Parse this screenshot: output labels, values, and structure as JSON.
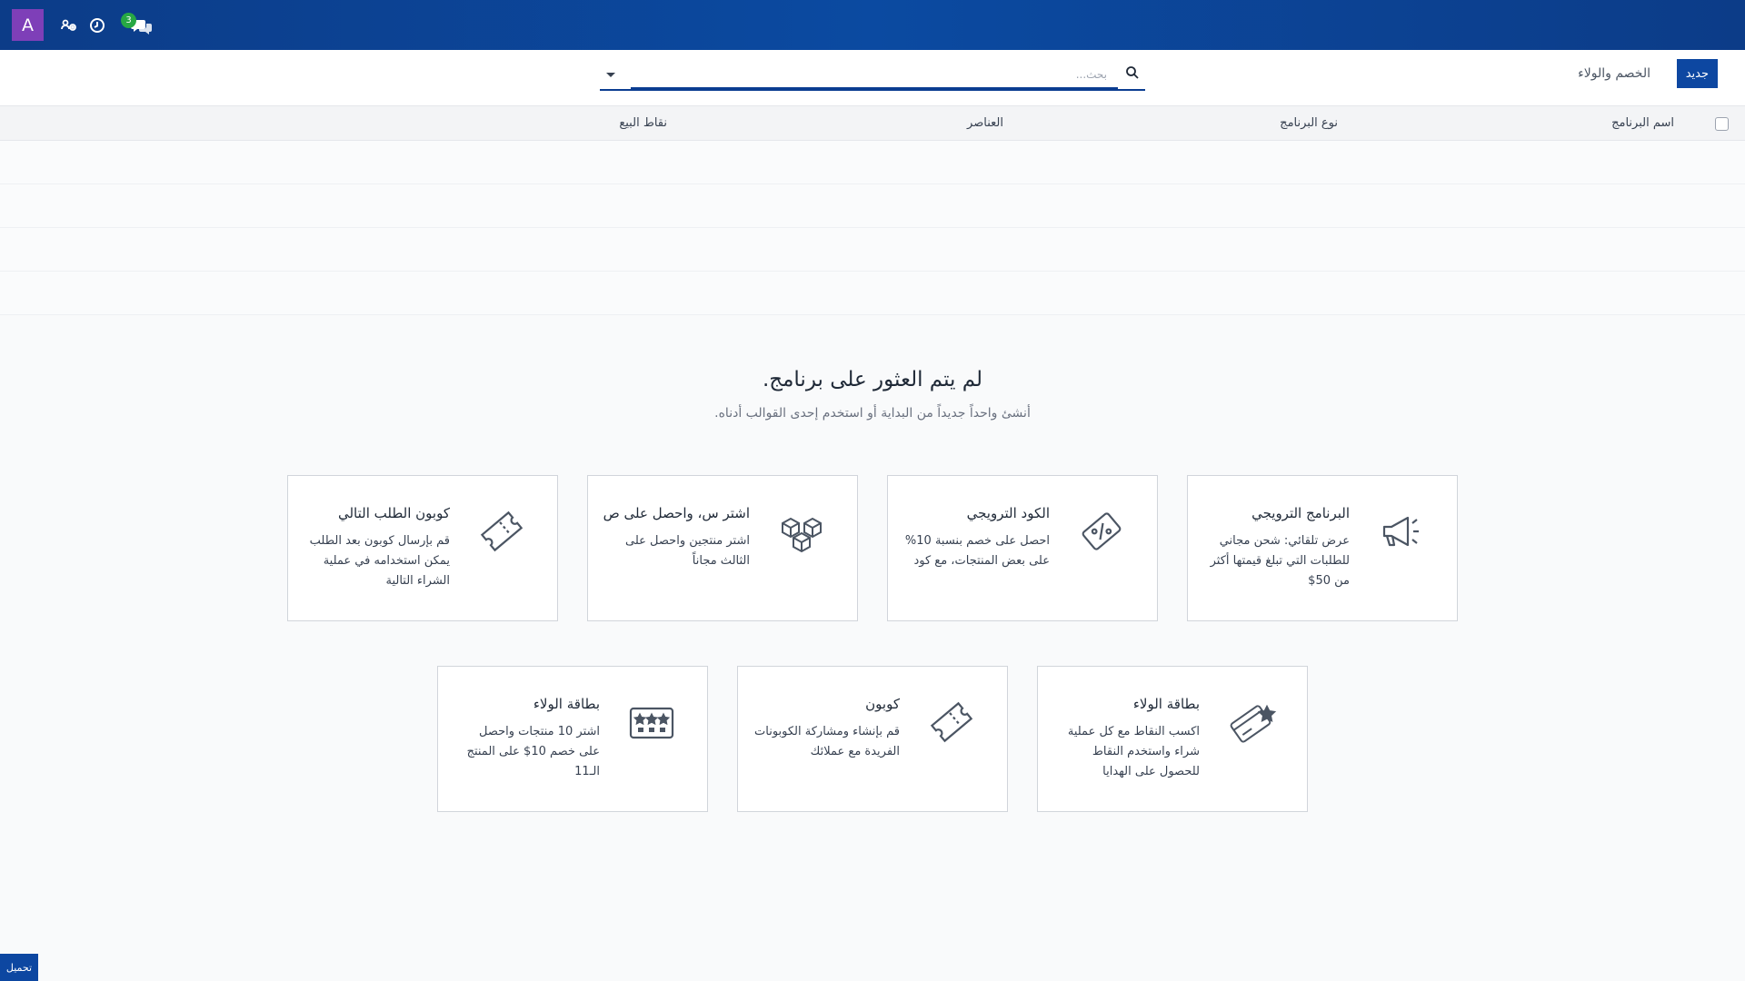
{
  "topbar": {
    "avatar_letter": "A",
    "notification_count": "3",
    "icons": [
      "users-gear-icon",
      "clock-icon",
      "chat-icon"
    ]
  },
  "toolbar": {
    "new_label": "جديد",
    "breadcrumb": "الخصم والولاء",
    "search_placeholder": "بحث..."
  },
  "table": {
    "columns": [
      "اسم البرنامج",
      "نوع البرنامج",
      "العناصر",
      "نقاط البيع"
    ]
  },
  "empty_state": {
    "title": "لم يتم العثور على برنامج.",
    "subtitle": "أنشئ واحداً جديداً من البداية أو استخدم إحدى القوالب أدناه."
  },
  "templates": [
    {
      "title": "البرنامج الترويجي",
      "desc": "عرض تلقائي: شحن مجاني للطلبات التي تبلغ قيمتها أكثر من 50$",
      "icon": "megaphone-icon"
    },
    {
      "title": "الكود الترويجي",
      "desc": "احصل على خصم بنسبة 10% على بعض المنتجات، مع كود",
      "icon": "discount-ticket-icon"
    },
    {
      "title": "اشتر س، واحصل على ص",
      "desc": "اشتر منتجين واحصل على الثالث مجاناً",
      "icon": "boxes-icon"
    },
    {
      "title": "كوبون الطلب التالي",
      "desc": "قم بإرسال كوبون بعد الطلب يمكن استخدامه في عملية الشراء التالية",
      "icon": "ticket-icon"
    },
    {
      "title": "بطاقة الولاء",
      "desc": "اكسب النقاط مع كل عملية شراء واستخدم النقاط للحصول على الهدايا",
      "icon": "loyalty-card-icon"
    },
    {
      "title": "كوبون",
      "desc": "قم بإنشاء ومشاركة الكوبونات الفريدة مع عملائك",
      "icon": "coupon-icon"
    },
    {
      "title": "بطاقة الولاء",
      "desc": "اشتر 10 منتجات واحصل على خصم 10$ على المنتج الـ11",
      "icon": "stamp-card-icon"
    }
  ],
  "footer": {
    "load_label": "تحميل"
  }
}
